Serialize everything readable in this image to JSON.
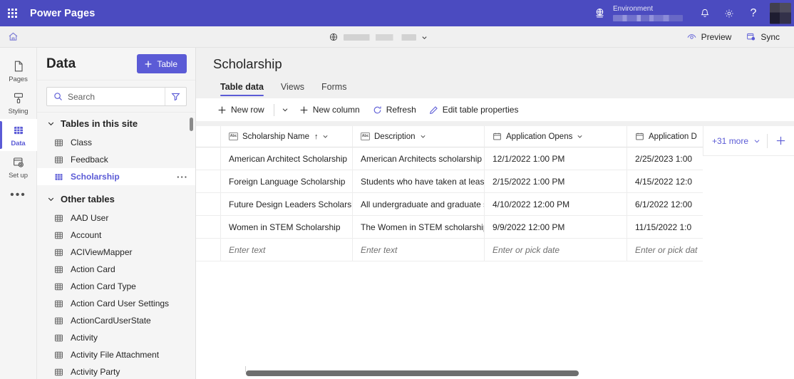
{
  "topbar": {
    "waffle_label": "app-launcher",
    "brand": "Power Pages",
    "environment_caption": "Environment",
    "environment_value": "",
    "icons": {
      "globe": "globe-icon",
      "bell": "notifications-icon",
      "gear": "settings-icon",
      "help": "help-icon",
      "avatar": "user-avatar"
    }
  },
  "sitebar": {
    "home": "home-icon",
    "site_name": "",
    "preview_label": "Preview",
    "sync_label": "Sync"
  },
  "rail": {
    "items": [
      {
        "label": "Pages",
        "icon": "page-icon",
        "active": false
      },
      {
        "label": "Styling",
        "icon": "brush-icon",
        "active": false
      },
      {
        "label": "Data",
        "icon": "data-grid-icon",
        "active": true
      },
      {
        "label": "Set up",
        "icon": "setup-icon",
        "active": false
      }
    ],
    "overflow_label": "•••"
  },
  "data_panel": {
    "title": "Data",
    "new_table_button": "Table",
    "search_placeholder": "Search",
    "search_value": "",
    "filter_icon": "filter-icon",
    "groups": [
      {
        "title": "Tables in this site",
        "expanded": true,
        "items": [
          {
            "name": "Class",
            "selected": false
          },
          {
            "name": "Feedback",
            "selected": false
          },
          {
            "name": "Scholarship",
            "selected": true,
            "overflow": "···"
          }
        ]
      },
      {
        "title": "Other tables",
        "expanded": true,
        "items": [
          {
            "name": "AAD User",
            "selected": false
          },
          {
            "name": "Account",
            "selected": false
          },
          {
            "name": "ACIViewMapper",
            "selected": false
          },
          {
            "name": "Action Card",
            "selected": false
          },
          {
            "name": "Action Card Type",
            "selected": false
          },
          {
            "name": "Action Card User Settings",
            "selected": false
          },
          {
            "name": "ActionCardUserState",
            "selected": false
          },
          {
            "name": "Activity",
            "selected": false
          },
          {
            "name": "Activity File Attachment",
            "selected": false
          },
          {
            "name": "Activity Party",
            "selected": false
          }
        ]
      }
    ]
  },
  "main": {
    "page_title": "Scholarship",
    "tabs": [
      {
        "label": "Table data",
        "active": true
      },
      {
        "label": "Views",
        "active": false
      },
      {
        "label": "Forms",
        "active": false
      }
    ],
    "commands": [
      {
        "label": "New row",
        "icon": "plus-icon"
      },
      {
        "label": "New column",
        "icon": "plus-icon"
      },
      {
        "label": "Refresh",
        "icon": "refresh-icon"
      },
      {
        "label": "Edit table properties",
        "icon": "pencil-icon"
      }
    ],
    "more_columns_label": "+31 more",
    "add_column_icon": "plus-icon"
  },
  "table": {
    "columns": [
      {
        "label": "Scholarship Name",
        "type_icon": "Abc",
        "sorted": true,
        "sort_arrow": "↑"
      },
      {
        "label": "Description",
        "type_icon": "Abc",
        "sorted": false
      },
      {
        "label": "Application Opens",
        "type_icon": "date",
        "sorted": false
      },
      {
        "label": "Application D",
        "type_icon": "date",
        "sorted": false
      }
    ],
    "rows": [
      {
        "name": "American Architect Scholarship",
        "description": "American Architects scholarship is...",
        "opens": "12/1/2022 1:00 PM",
        "due": "2/25/2023 1:00"
      },
      {
        "name": "Foreign Language Scholarship",
        "description": "Students who have taken at least ...",
        "opens": "2/15/2022 1:00 PM",
        "due": "4/15/2022 12:0"
      },
      {
        "name": "Future Design Leaders Scholarship",
        "description": "All undergraduate and graduate s...",
        "opens": "4/10/2022 12:00 PM",
        "due": "6/1/2022 12:00"
      },
      {
        "name": "Women in STEM Scholarship",
        "description": "The Women in STEM scholarship i...",
        "opens": "9/9/2022 12:00 PM",
        "due": "11/15/2022 1:0"
      }
    ],
    "new_row": {
      "name": "Enter text",
      "description": "Enter text",
      "opens": "Enter or pick date",
      "due": "Enter or pick dat"
    }
  },
  "colors": {
    "brand": "#4b4bc0",
    "accent": "#5b5bd6",
    "panel_bg": "#f5f5f5",
    "grid_line": "#ededed"
  }
}
